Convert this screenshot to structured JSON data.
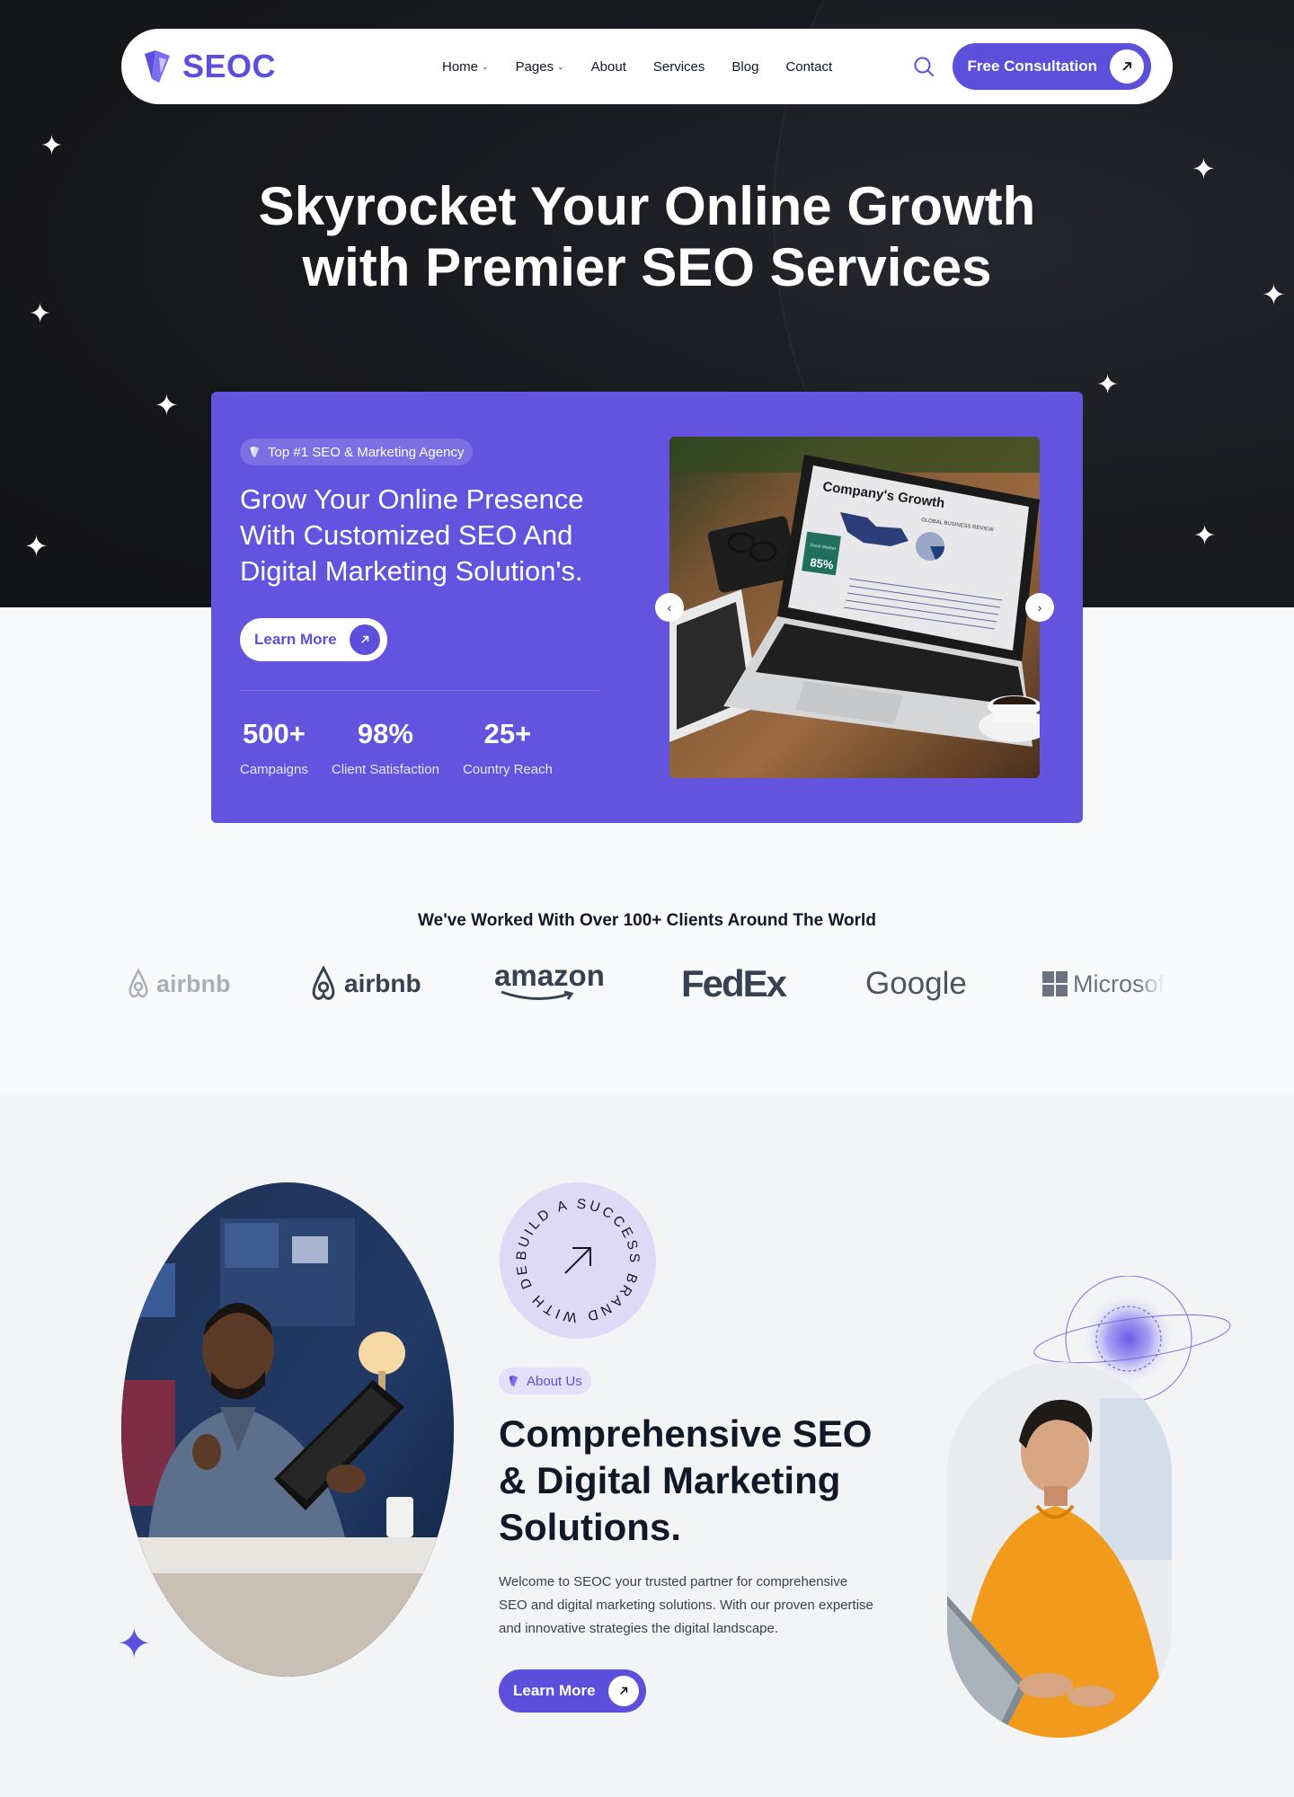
{
  "brand": {
    "name": "SEOC",
    "accent": "#5b4fdb",
    "card_color": "#6353de"
  },
  "nav": {
    "items": [
      {
        "label": "Home",
        "dropdown": true
      },
      {
        "label": "Pages",
        "dropdown": true
      },
      {
        "label": "About",
        "dropdown": false
      },
      {
        "label": "Services",
        "dropdown": false
      },
      {
        "label": "Blog",
        "dropdown": false
      },
      {
        "label": "Contact",
        "dropdown": false
      }
    ],
    "search_icon": "search-icon",
    "cta_label": "Free Consultation"
  },
  "hero": {
    "title_line1": "Skyrocket Your Online Growth",
    "title_line2": "with Premier SEO Services"
  },
  "promo": {
    "badge": "Top #1 SEO & Marketing Agency",
    "heading_line1": "Grow Your Online Presence",
    "heading_line2": "With Customized SEO And",
    "heading_line3": "Digital Marketing Solution's.",
    "button_label": "Learn More",
    "stats": [
      {
        "value": "500+",
        "label": "Campaigns"
      },
      {
        "value": "98%",
        "label": "Client Satisfaction"
      },
      {
        "value": "25+",
        "label": "Country Reach"
      }
    ],
    "image": {
      "screen_title": "Company's Growth",
      "screen_subtitle": "GLOBAL BUSINESS REVIEW",
      "stat_label": "Stock Market",
      "stat_value": "85%"
    },
    "prev_icon": "chevron-left-icon",
    "next_icon": "chevron-right-icon"
  },
  "clients": {
    "title": "We've Worked With Over 100+ Clients Around The World",
    "logos": [
      "airbnb",
      "airbnb",
      "amazon",
      "FedEx",
      "Google",
      "Microsof"
    ]
  },
  "about": {
    "circle_text": "BUILD A SUCCESS BRAND WITH DEMOUI",
    "badge": "About Us",
    "heading_line1": "Comprehensive SEO",
    "heading_line2": "& Digital Marketing",
    "heading_line3": "Solutions.",
    "text_line1": "Welcome to SEOC your trusted partner for comprehensive",
    "text_line2": "SEO and digital marketing solutions. With our proven expertise",
    "text_line3": "and innovative strategies the digital landscape.",
    "button_label": "Learn More"
  }
}
